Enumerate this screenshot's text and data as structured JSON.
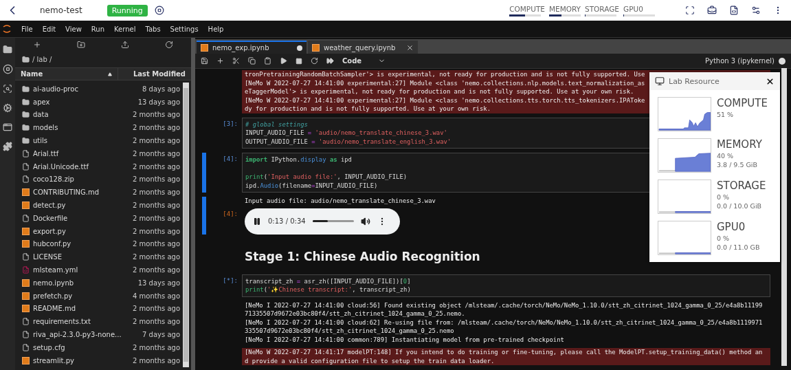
{
  "top_bar": {
    "project": "nemo-test",
    "status": "Running",
    "meters": [
      {
        "label": "COMPUTE",
        "level": 0.5
      },
      {
        "label": "MEMORY",
        "level": 0.4
      },
      {
        "label": "STORAGE",
        "level": 0
      },
      {
        "label": "GPU0",
        "level": 0
      }
    ]
  },
  "menu": [
    "File",
    "Edit",
    "View",
    "Run",
    "Kernel",
    "Tabs",
    "Settings",
    "Help"
  ],
  "file_browser": {
    "path": "/ lab /",
    "columns": [
      "Name",
      "Last Modified"
    ],
    "files": [
      {
        "name": "ai-audio-proc",
        "modified": "8 days ago",
        "kind": "folder"
      },
      {
        "name": "apex",
        "modified": "13 days ago",
        "kind": "folder"
      },
      {
        "name": "data",
        "modified": "2 months ago",
        "kind": "folder"
      },
      {
        "name": "models",
        "modified": "2 months ago",
        "kind": "folder"
      },
      {
        "name": "utils",
        "modified": "2 months ago",
        "kind": "folder"
      },
      {
        "name": "Arial.ttf",
        "modified": "2 months ago",
        "kind": "file"
      },
      {
        "name": "Arial.Unicode.ttf",
        "modified": "2 months ago",
        "kind": "file"
      },
      {
        "name": "coco128.zip",
        "modified": "2 months ago",
        "kind": "file"
      },
      {
        "name": "CONTRIBUTING.md",
        "modified": "2 months ago",
        "kind": "app"
      },
      {
        "name": "detect.py",
        "modified": "2 months ago",
        "kind": "app"
      },
      {
        "name": "Dockerfile",
        "modified": "2 months ago",
        "kind": "file"
      },
      {
        "name": "export.py",
        "modified": "2 months ago",
        "kind": "app"
      },
      {
        "name": "hubconf.py",
        "modified": "2 months ago",
        "kind": "app"
      },
      {
        "name": "LICENSE",
        "modified": "2 months ago",
        "kind": "file"
      },
      {
        "name": "mlsteam.yml",
        "modified": "2 months ago",
        "kind": "yaml"
      },
      {
        "name": "nemo.ipynb",
        "modified": "13 days ago",
        "kind": "app"
      },
      {
        "name": "prefetch.py",
        "modified": "4 months ago",
        "kind": "app"
      },
      {
        "name": "README.md",
        "modified": "2 months ago",
        "kind": "app"
      },
      {
        "name": "requirements.txt",
        "modified": "2 months ago",
        "kind": "file"
      },
      {
        "name": "riva_api-2.3.0-py3-none...",
        "modified": "7 days ago",
        "kind": "file"
      },
      {
        "name": "setup.cfg",
        "modified": "2 months ago",
        "kind": "file"
      },
      {
        "name": "streamlit.py",
        "modified": "2 months ago",
        "kind": "app"
      }
    ]
  },
  "notebook": {
    "tabs": [
      {
        "label": "nemo_exp.ipynb",
        "selected": true,
        "modified": true
      },
      {
        "label": "weather_query.ipynb",
        "selected": false,
        "modified": false
      }
    ],
    "cell_type": "Code",
    "kernel": "Python 3 (ipykernel)",
    "cells": [
      {
        "kind": "stderr",
        "lines": [
          "tronPretrainingRandomBatchSampler'> is experimental, not ready for production and is not fully supported. Use",
          "[NeMo W 2022-07-27 14:41:00 experimental:27] Module <class 'nemo.collections.nlp.models.text_normalization_as",
          "eTaggerModel'> is experimental, not ready for production and is not fully supported. Use at your own risk.",
          "[NeMo W 2022-07-27 14:41:00 experimental:27] Module <class 'nemo.collections.tts.torch.tts_tokenizers.IPAToke",
          "dy for production and is not fully supported. Use at your own risk."
        ]
      },
      {
        "kind": "code",
        "prompt": "[3]:",
        "active": false,
        "lines": [
          {
            "tokens": [
              {
                "kind": "comment",
                "text": "# global settings"
              }
            ]
          },
          {
            "tokens": [
              {
                "kind": "name",
                "text": "INPUT_AUDIO_FILE "
              },
              {
                "kind": "op",
                "text": "="
              },
              {
                "kind": "string",
                "text": " 'audio/nemo_translate_chinese_3.wav'"
              }
            ]
          },
          {
            "tokens": [
              {
                "kind": "name",
                "text": "OUTPUT_AUDIO_FILE "
              },
              {
                "kind": "op",
                "text": "="
              },
              {
                "kind": "string",
                "text": " 'audio/nemo_translate_english_3.wav'"
              }
            ]
          }
        ]
      },
      {
        "kind": "code",
        "prompt": "[4]:",
        "active": true,
        "lines": [
          {
            "tokens": [
              {
                "kind": "keyword",
                "text": "import"
              },
              {
                "kind": "name",
                "text": " IPython."
              },
              {
                "kind": "attr",
                "text": "display"
              },
              {
                "kind": "keyword",
                "text": " as"
              },
              {
                "kind": "name",
                "text": " ipd"
              }
            ]
          },
          {
            "gap_before": true,
            "tokens": [
              {
                "kind": "builtin",
                "text": "print"
              },
              {
                "kind": "name",
                "text": "("
              },
              {
                "kind": "string",
                "text": "'Input audio file:'"
              },
              {
                "kind": "name",
                "text": ", INPUT_AUDIO_FILE)"
              }
            ]
          },
          {
            "tokens": [
              {
                "kind": "name",
                "text": "ipd."
              },
              {
                "kind": "attr",
                "text": "Audio"
              },
              {
                "kind": "name",
                "text": "(filename"
              },
              {
                "kind": "op",
                "text": "="
              },
              {
                "kind": "name",
                "text": "INPUT_AUDIO_FILE)"
              }
            ]
          }
        ]
      },
      {
        "kind": "output",
        "prompt": "[4]:",
        "active": true,
        "stdout": [
          "Input audio file: audio/nemo_translate_chinese_3.wav"
        ],
        "audio": {
          "time": "0:13 / 0:34",
          "level": 0.38
        }
      },
      {
        "kind": "markdown",
        "heading": "Stage 1: Chinese Audio Recognition"
      },
      {
        "kind": "code",
        "prompt": "[*]:",
        "active": false,
        "lines": [
          {
            "tokens": [
              {
                "kind": "name",
                "text": "transcript_zh "
              },
              {
                "kind": "op",
                "text": "="
              },
              {
                "kind": "name",
                "text": " asr_zh([INPUT_AUDIO_FILE])["
              },
              {
                "kind": "number",
                "text": "0"
              },
              {
                "kind": "name",
                "text": "]"
              }
            ]
          },
          {
            "tokens": [
              {
                "kind": "builtin",
                "text": "print"
              },
              {
                "kind": "name",
                "text": "("
              },
              {
                "kind": "string",
                "text": "'✨Chinese transcript:'"
              },
              {
                "kind": "name",
                "text": ", transcript_zh)"
              }
            ]
          }
        ]
      },
      {
        "kind": "stdout",
        "lines": [
          "[NeMo I 2022-07-27 14:41:00 cloud:56] Found existing object /mlsteam/.cache/torch/NeMo/NeMo_1.10.0/stt_zh_citrinet_1024_gamma_0_25/e4a8b11199",
          "71335507d9672e03bc80f4/stt_zh_citrinet_1024_gamma_0_25.nemo.",
          "[NeMo I 2022-07-27 14:41:00 cloud:62] Re-using file from: /mlsteam/.cache/torch/NeMo/NeMo_1.10.0/stt_zh_citrinet_1024_gamma_0_25/e4a8b1119971",
          "335507d9672e03bc80f4/stt_zh_citrinet_1024_gamma_0_25.nemo",
          "[NeMo I 2022-07-27 14:41:00 common:789] Instantiating model from pre-trained checkpoint"
        ]
      },
      {
        "kind": "stderr",
        "lines": [
          "[NeMo W 2022-07-27 14:41:17 modelPT:148] If you intend to do training or fine-tuning, please call the ModelPT.setup_training_data() method an",
          "d provide a valid configuration file to setup the train data loader."
        ]
      }
    ]
  },
  "lab_resource": {
    "title": "Lab Resource",
    "resources": [
      {
        "name": "COMPUTE",
        "percent": "51 %"
      },
      {
        "name": "MEMORY",
        "percent": "40 %",
        "usage": "3.8 / 9.5 GiB"
      },
      {
        "name": "STORAGE",
        "percent": "0 %",
        "usage": "0.0 / 10.0 GiB"
      },
      {
        "name": "GPU0",
        "percent": "0 %",
        "usage": "0.0 / 11.0 GB"
      }
    ]
  }
}
